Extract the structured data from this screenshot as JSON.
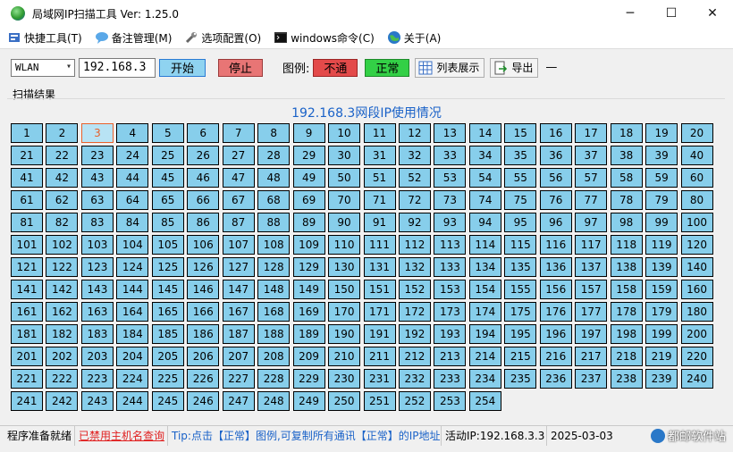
{
  "window": {
    "title": "局域网IP扫描工具  Ver: 1.25.0",
    "minimize_glyph": "─",
    "maximize_glyph": "☐",
    "close_glyph": "✕"
  },
  "menu": [
    {
      "label": "快捷工具(T)",
      "icon": "tools-icon"
    },
    {
      "label": "备注管理(M)",
      "icon": "chat-icon"
    },
    {
      "label": "选项配置(O)",
      "icon": "wrench-icon"
    },
    {
      "label": "windows命令(C)",
      "icon": "terminal-icon"
    },
    {
      "label": "关于(A)",
      "icon": "globe-icon"
    }
  ],
  "toolbar": {
    "interface_select": "WLAN",
    "ip_value": "192.168.3",
    "start_label": "开始",
    "stop_label": "停止",
    "legend_label": "图例:",
    "legend_offline": "不通",
    "legend_online": "正常",
    "list_view_label": "列表展示",
    "export_label": "导出",
    "trailing": "—"
  },
  "results": {
    "group_label": "扫描结果",
    "range_title": "192.168.3网段IP使用情况",
    "selected": 3,
    "first": 1,
    "last": 254,
    "colors": {
      "normal": "#87ceeb",
      "selected_border": "#e8602a"
    }
  },
  "status": {
    "ready": "程序准备就绪",
    "hostname_link": "已禁用主机名查询",
    "tip": "Tip:点击【正常】图例,可复制所有通讯【正常】的IP地址",
    "active_ip": "活动IP:192.168.3.3",
    "datetime": "2025-03-03 ",
    "watermark": "都邮软件站"
  }
}
